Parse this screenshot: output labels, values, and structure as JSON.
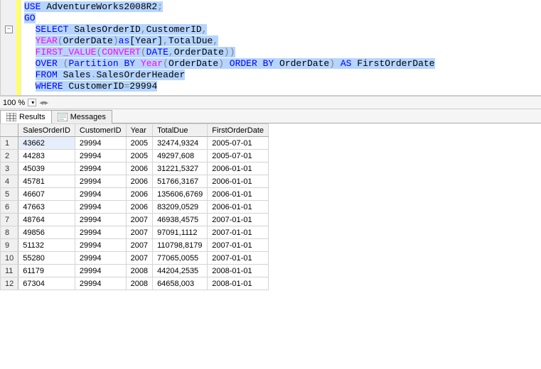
{
  "zoom": {
    "level": "100 %"
  },
  "code": {
    "lines": [
      {
        "segs": [
          {
            "t": "USE",
            "c": "kw-blue",
            "hl": true
          },
          {
            "t": " AdventureWorks2008R2",
            "c": "txt-black",
            "hl": true
          },
          {
            "t": ";",
            "c": "op-gray",
            "hl": true
          }
        ]
      },
      {
        "segs": [
          {
            "t": "GO",
            "c": "kw-blue",
            "hl": true
          }
        ]
      },
      {
        "segs": [
          {
            "t": "SELECT",
            "c": "kw-blue",
            "hl": true
          },
          {
            "t": " SalesOrderID",
            "c": "txt-black",
            "hl": true
          },
          {
            "t": ",",
            "c": "op-gray",
            "hl": true
          },
          {
            "t": "CustomerID",
            "c": "txt-black",
            "hl": true
          },
          {
            "t": ",",
            "c": "op-gray",
            "hl": true
          }
        ]
      },
      {
        "segs": [
          {
            "t": "YEAR",
            "c": "kw-pink",
            "hl": true
          },
          {
            "t": "(",
            "c": "op-gray",
            "hl": true
          },
          {
            "t": "OrderDate",
            "c": "txt-black",
            "hl": true
          },
          {
            "t": ")",
            "c": "op-gray",
            "hl": true
          },
          {
            "t": "as",
            "c": "kw-blue",
            "hl": true
          },
          {
            "t": "[Year]",
            "c": "txt-black",
            "hl": true
          },
          {
            "t": ",",
            "c": "op-gray",
            "hl": true
          },
          {
            "t": "TotalDue",
            "c": "txt-black",
            "hl": true
          },
          {
            "t": ",",
            "c": "op-gray",
            "hl": true
          }
        ]
      },
      {
        "segs": [
          {
            "t": "FIRST_VALUE",
            "c": "kw-pink",
            "hl": true
          },
          {
            "t": "(",
            "c": "op-gray",
            "hl": true
          },
          {
            "t": "CONVERT",
            "c": "kw-pink",
            "hl": true
          },
          {
            "t": "(",
            "c": "op-gray",
            "hl": true
          },
          {
            "t": "DATE",
            "c": "kw-blue",
            "hl": true
          },
          {
            "t": ",",
            "c": "op-gray",
            "hl": true
          },
          {
            "t": "OrderDate",
            "c": "txt-black",
            "hl": true
          },
          {
            "t": "))",
            "c": "op-gray",
            "hl": true
          }
        ]
      },
      {
        "segs": [
          {
            "t": "OVER",
            "c": "kw-blue",
            "hl": true
          },
          {
            "t": " ",
            "c": "txt-black",
            "hl": true
          },
          {
            "t": "(",
            "c": "op-gray",
            "hl": true
          },
          {
            "t": "Partition",
            "c": "kw-blue",
            "hl": true
          },
          {
            "t": " ",
            "c": "txt-black",
            "hl": true
          },
          {
            "t": "BY",
            "c": "kw-blue",
            "hl": true
          },
          {
            "t": " ",
            "c": "txt-black",
            "hl": true
          },
          {
            "t": "Year",
            "c": "kw-pink",
            "hl": true
          },
          {
            "t": "(",
            "c": "op-gray",
            "hl": true
          },
          {
            "t": "OrderDate",
            "c": "txt-black",
            "hl": true
          },
          {
            "t": ")",
            "c": "op-gray",
            "hl": true
          },
          {
            "t": " ",
            "c": "txt-black",
            "hl": true
          },
          {
            "t": "ORDER",
            "c": "kw-blue",
            "hl": true
          },
          {
            "t": " ",
            "c": "txt-black",
            "hl": true
          },
          {
            "t": "BY",
            "c": "kw-blue",
            "hl": true
          },
          {
            "t": " OrderDate",
            "c": "txt-black",
            "hl": true
          },
          {
            "t": ")",
            "c": "op-gray",
            "hl": true
          },
          {
            "t": " ",
            "c": "txt-black",
            "hl": true
          },
          {
            "t": "AS",
            "c": "kw-blue",
            "hl": true
          },
          {
            "t": " FirstOrderDate",
            "c": "txt-black",
            "hl": true
          }
        ]
      },
      {
        "segs": [
          {
            "t": "FROM",
            "c": "kw-blue",
            "hl": true
          },
          {
            "t": " Sales",
            "c": "txt-black",
            "hl": true
          },
          {
            "t": ".",
            "c": "op-gray",
            "hl": true
          },
          {
            "t": "SalesOrderHeader",
            "c": "txt-black",
            "hl": true
          }
        ]
      },
      {
        "segs": [
          {
            "t": "WHERE",
            "c": "kw-blue",
            "hl": true
          },
          {
            "t": " CustomerID",
            "c": "txt-black",
            "hl": true
          },
          {
            "t": "=",
            "c": "op-gray",
            "hl": true
          },
          {
            "t": "29994",
            "c": "txt-black",
            "hl": true
          }
        ]
      }
    ],
    "indent_from": 3
  },
  "tabs": {
    "results": "Results",
    "messages": "Messages"
  },
  "grid": {
    "headers": [
      "SalesOrderID",
      "CustomerID",
      "Year",
      "TotalDue",
      "FirstOrderDate"
    ],
    "rows": [
      [
        "43662",
        "29994",
        "2005",
        "32474,9324",
        "2005-07-01"
      ],
      [
        "44283",
        "29994",
        "2005",
        "49297,608",
        "2005-07-01"
      ],
      [
        "45039",
        "29994",
        "2006",
        "31221,5327",
        "2006-01-01"
      ],
      [
        "45781",
        "29994",
        "2006",
        "51766,3167",
        "2006-01-01"
      ],
      [
        "46607",
        "29994",
        "2006",
        "135606,6769",
        "2006-01-01"
      ],
      [
        "47663",
        "29994",
        "2006",
        "83209,0529",
        "2006-01-01"
      ],
      [
        "48764",
        "29994",
        "2007",
        "46938,4575",
        "2007-01-01"
      ],
      [
        "49856",
        "29994",
        "2007",
        "97091,1112",
        "2007-01-01"
      ],
      [
        "51132",
        "29994",
        "2007",
        "110798,8179",
        "2007-01-01"
      ],
      [
        "55280",
        "29994",
        "2007",
        "77065,0055",
        "2007-01-01"
      ],
      [
        "61179",
        "29994",
        "2008",
        "44204,2535",
        "2008-01-01"
      ],
      [
        "67304",
        "29994",
        "2008",
        "64658,003",
        "2008-01-01"
      ]
    ]
  }
}
